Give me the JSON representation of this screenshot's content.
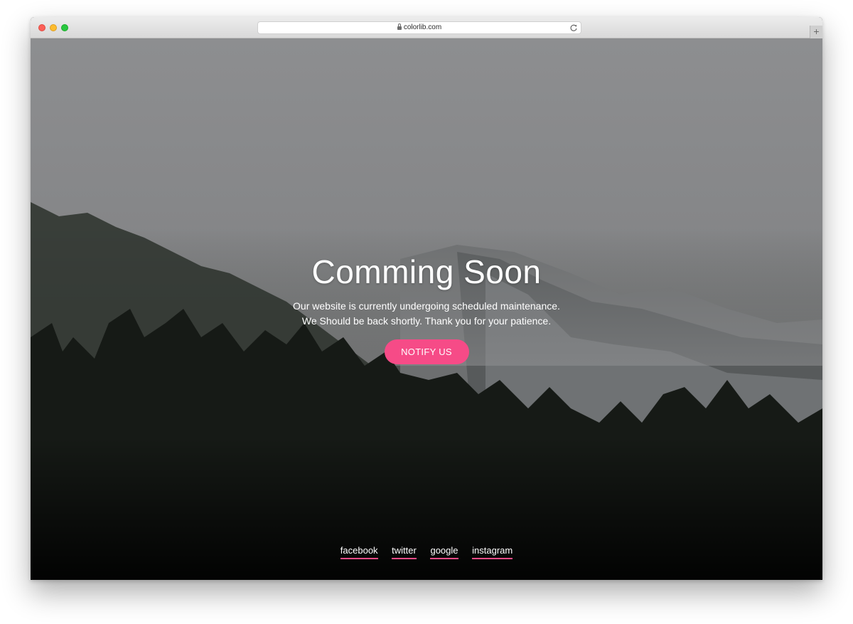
{
  "browser": {
    "url": "colorlib.com",
    "newtab_label": "+"
  },
  "hero": {
    "title": "Comming Soon",
    "line1": "Our website is currently undergoing scheduled maintenance.",
    "line2": "We Should be back shortly. Thank you for your patience.",
    "button_label": "NOTIFY US"
  },
  "social": {
    "links": [
      "facebook",
      "twitter",
      "google",
      "instagram"
    ]
  },
  "colors": {
    "accent": "#f64b87",
    "text": "#ffffff"
  },
  "icons": {
    "secure": "lock-icon",
    "reload": "reload-icon"
  }
}
